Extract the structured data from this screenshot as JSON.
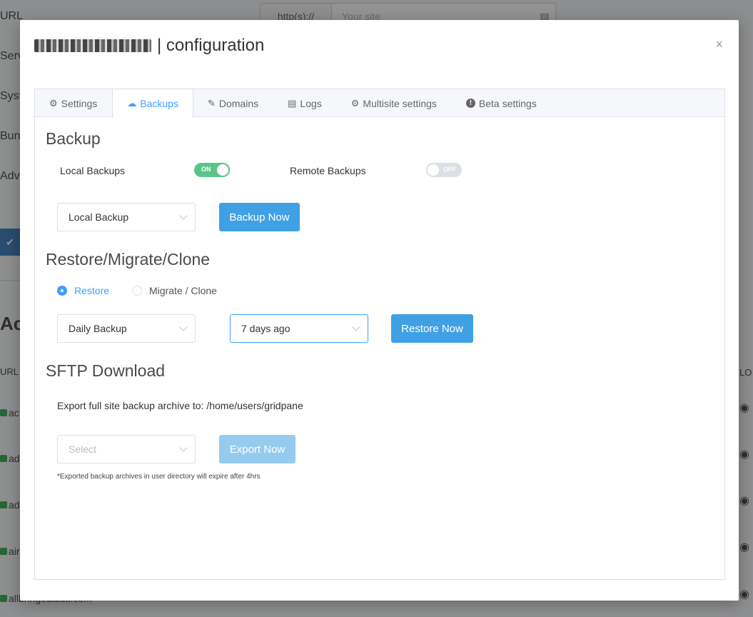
{
  "background": {
    "labels": [
      "URL",
      "Serv",
      "Syst",
      "Bun",
      "Adva"
    ],
    "url_prefix": "http(s)://",
    "url_placeholder": "Your site",
    "section_heading": "Act",
    "col_url": "URL",
    "col_right": "LO",
    "rows": [
      "ac",
      "ad",
      "ad",
      "air",
      "allbringedaluti.com"
    ]
  },
  "modal": {
    "title_suffix": "| configuration",
    "close_label": "×",
    "tabs": [
      {
        "label": "Settings",
        "icon": "gear-icon"
      },
      {
        "label": "Backups",
        "icon": "cloud-upload-icon"
      },
      {
        "label": "Domains",
        "icon": "edit-icon"
      },
      {
        "label": "Logs",
        "icon": "document-icon"
      },
      {
        "label": "Multisite settings",
        "icon": "gear-icon"
      },
      {
        "label": "Beta settings",
        "icon": "info-icon"
      }
    ],
    "active_tab": "Backups"
  },
  "backup": {
    "title": "Backup",
    "local_label": "Local Backups",
    "local_toggle": "ON",
    "remote_label": "Remote Backups",
    "remote_toggle": "OFF",
    "type_select": "Local Backup",
    "backup_now": "Backup Now"
  },
  "restore": {
    "title": "Restore/Migrate/Clone",
    "option_restore": "Restore",
    "option_migrate": "Migrate / Clone",
    "selected_option": "Restore",
    "backup_select": "Daily Backup",
    "time_select": "7 days ago",
    "restore_now": "Restore Now"
  },
  "sftp": {
    "title": "SFTP Download",
    "export_text": "Export full site backup archive to: /home/users/gridpane",
    "select_placeholder": "Select",
    "export_now": "Export Now",
    "note": "*Exported backup archives in user directory will expire after 4hrs"
  },
  "colors": {
    "accent": "#409eff",
    "button": "#3fa1e3",
    "toggle_on": "#5cc489"
  }
}
